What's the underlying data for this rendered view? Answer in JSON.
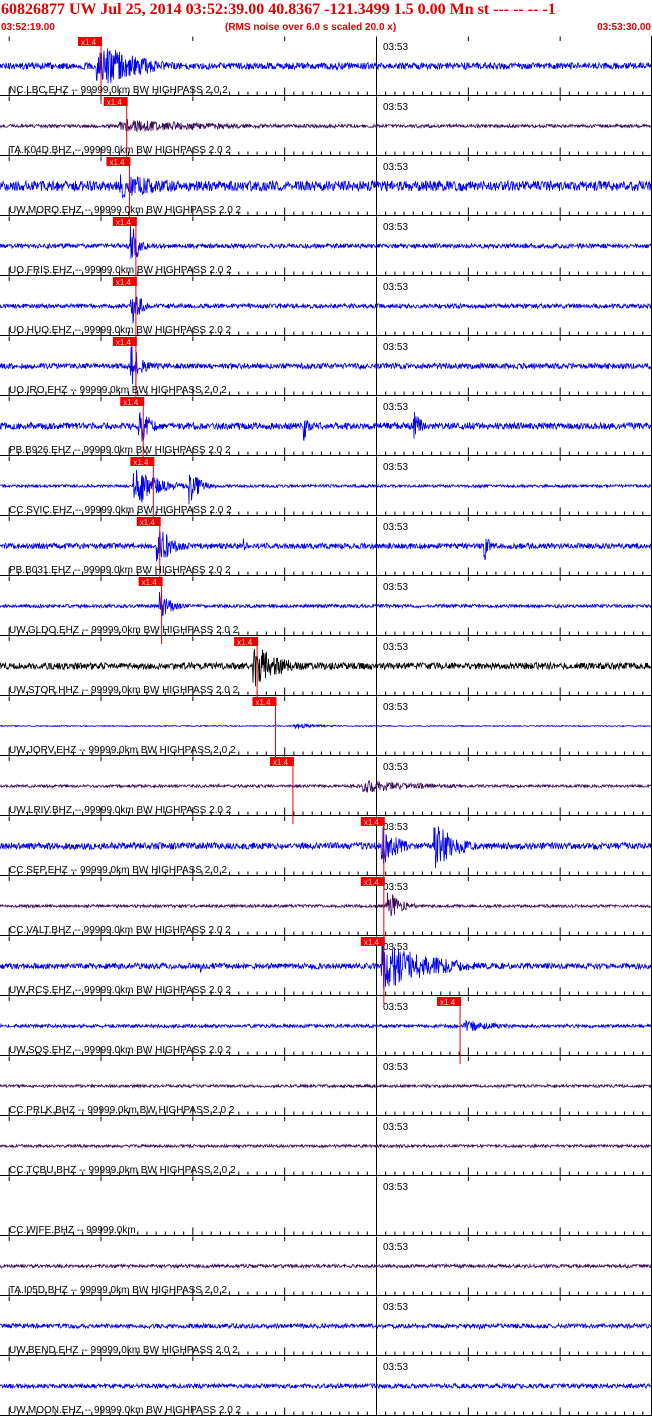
{
  "header": {
    "title": "60826877 UW Jul 25, 2014 03:52:39.00   40.8367 -121.3499  1.5 0.00 Mn st --- -- --  -1",
    "start_time": "03:52:19.00",
    "end_time": "03:53:30.00",
    "note": "(RMS noise over 6.0 s scaled 20.0 x)"
  },
  "colors": {
    "header_text": "#e00000",
    "trace_blue": "#0000ee",
    "trace_purple": "#3a0a5e",
    "trace_black": "#000000",
    "pick_marker": "#ee0000",
    "axis": "#000000"
  },
  "chart_data": {
    "type": "line",
    "x_unit": "time",
    "x_range": [
      "03:52:19.00",
      "03:53:30.00"
    ],
    "minute_mark_label": "03:53",
    "pick_label": "x1.4",
    "traces": [
      {
        "label": "NC.LBC.EHZ -- 99999.0km BW  HIGHPASS  2.0  2",
        "color": "blue",
        "pick_time_s": 9.8,
        "amplitude": 0.12,
        "events": [
          {
            "t": 10.5,
            "dur": 7,
            "amp": 0.95
          }
        ]
      },
      {
        "label": "TA.K04D.BHZ -- 99999.0km BW  HIGHPASS  2.0  2",
        "color": "purple",
        "pick_time_s": 12.6,
        "amplitude": 0.06,
        "events": [
          {
            "t": 13,
            "dur": 20,
            "amp": 0.25
          }
        ]
      },
      {
        "label": "UW.MORO.EHZ -- 99999.0km BW  HIGHPASS  2.0  2",
        "color": "blue",
        "pick_time_s": 12.9,
        "amplitude": 0.18,
        "events": [
          {
            "t": 13,
            "dur": 13,
            "amp": 0.45
          }
        ]
      },
      {
        "label": "UO.FRIS.EHZ -- 99999.0km BW  HIGHPASS  2.0  2",
        "color": "blue",
        "pick_time_s": 13.6,
        "amplitude": 0.08,
        "events": [
          {
            "t": 14.2,
            "dur": 1.5,
            "amp": 1.0
          }
        ]
      },
      {
        "label": "UO.HUO.EHZ -- 99999.0km BW  HIGHPASS  2.0  2",
        "color": "blue",
        "pick_time_s": 13.6,
        "amplitude": 0.08,
        "events": [
          {
            "t": 14.2,
            "dur": 1.5,
            "amp": 1.0
          }
        ]
      },
      {
        "label": "UO.IRO.EHZ -- 99999.0km BW  HIGHPASS  2.0  2",
        "color": "blue",
        "pick_time_s": 13.6,
        "amplitude": 0.1,
        "events": [
          {
            "t": 14.2,
            "dur": 1.8,
            "amp": 0.95
          }
        ]
      },
      {
        "label": "PB.B926.EHZ -- 99999.0km BW  HIGHPASS  2.0  2",
        "color": "blue",
        "pick_time_s": 14.4,
        "amplitude": 0.12,
        "events": [
          {
            "t": 15.0,
            "dur": 2,
            "amp": 0.9
          },
          {
            "t": 33,
            "dur": 0.8,
            "amp": 0.7
          },
          {
            "t": 45,
            "dur": 1.5,
            "amp": 0.6
          }
        ]
      },
      {
        "label": "CC.SVIC.EHZ -- 99999.0km BW  HIGHPASS  2.0  2",
        "color": "blue",
        "pick_time_s": 15.5,
        "amplitude": 0.05,
        "events": [
          {
            "t": 14.5,
            "dur": 4,
            "amp": 0.9
          },
          {
            "t": 20.5,
            "dur": 2,
            "amp": 0.7
          }
        ]
      },
      {
        "label": "PB.B031.EHZ -- 99999.0km BW  HIGHPASS  2.0  2",
        "color": "blue",
        "pick_time_s": 16.2,
        "amplitude": 0.1,
        "events": [
          {
            "t": 17,
            "dur": 3,
            "amp": 0.8
          },
          {
            "t": 26.5,
            "dur": 1,
            "amp": 0.3
          },
          {
            "t": 52.6,
            "dur": 0.8,
            "amp": 0.9
          }
        ]
      },
      {
        "label": "UW.GLDO.EHZ -- 99999.0km BW  HIGHPASS  2.0  2",
        "color": "blue",
        "pick_time_s": 16.4,
        "amplitude": 0.06,
        "events": [
          {
            "t": 17.3,
            "dur": 2,
            "amp": 0.7
          }
        ]
      },
      {
        "label": "UW.STOR.HHZ -- 99999.0km BW  HIGHPASS  2.0  2",
        "color": "black",
        "pick_time_s": 26.8,
        "amplitude": 0.12,
        "events": [
          {
            "t": 27.5,
            "dur": 5,
            "amp": 0.85
          }
        ]
      },
      {
        "label": "UW.JORV.EHZ -- 99999.0km BW  HIGHPASS  2.0  2",
        "color": "blue",
        "pick_time_s": 28.8,
        "amplitude": 0.02,
        "events": [
          {
            "t": 32,
            "dur": 5,
            "amp": 0.12
          }
        ]
      },
      {
        "label": "UW.LRIV.BHZ -- 99999.0km BW  HIGHPASS  2.0  2",
        "color": "purple",
        "pick_time_s": 30.7,
        "amplitude": 0.05,
        "events": [
          {
            "t": 39.5,
            "dur": 12,
            "amp": 0.25
          }
        ]
      },
      {
        "label": "CC.SEP.EHZ -- 99999.0km BW  HIGHPASS  2.0  2",
        "color": "blue",
        "pick_time_s": 40.6,
        "amplitude": 0.12,
        "events": [
          {
            "t": 41.5,
            "dur": 3,
            "amp": 0.8
          },
          {
            "t": 47.2,
            "dur": 4,
            "amp": 0.95
          }
        ]
      },
      {
        "label": "CC.VALT.BHZ -- 99999.0km BW  HIGHPASS  2.0  2",
        "color": "purple",
        "pick_time_s": 40.6,
        "amplitude": 0.05,
        "events": [
          {
            "t": 42,
            "dur": 2.5,
            "amp": 0.7
          }
        ]
      },
      {
        "label": "UW.RCS.EHZ -- 99999.0km BW  HIGHPASS  2.0  2",
        "color": "blue",
        "pick_time_s": 40.6,
        "amplitude": 0.1,
        "events": [
          {
            "t": 41.5,
            "dur": 9,
            "amp": 0.95
          },
          {
            "t": 21.8,
            "dur": 0.6,
            "amp": 0.3
          }
        ]
      },
      {
        "label": "UW.SQS.EHZ -- 99999.0km BW  HIGHPASS  2.0  2",
        "color": "blue",
        "pick_time_s": 48.9,
        "amplitude": 0.06,
        "events": [
          {
            "t": 50.5,
            "dur": 8,
            "amp": 0.22
          }
        ]
      },
      {
        "label": "CC.PRLK.BHZ -- 99999.0km BW  HIGHPASS  2.0  2",
        "color": "purple",
        "pick_time_s": null,
        "amplitude": 0.05,
        "events": []
      },
      {
        "label": "CC.TCBU.BHZ -- 99999.0km BW  HIGHPASS  2.0  2",
        "color": "purple",
        "pick_time_s": null,
        "amplitude": 0.05,
        "events": []
      },
      {
        "label": "CC.WIFE.BHZ -- 99999.0km",
        "color": "none",
        "pick_time_s": null,
        "amplitude": 0,
        "events": []
      },
      {
        "label": "TA.I05D.BHZ -- 99999.0km BW  HIGHPASS  2.0  2",
        "color": "purple",
        "pick_time_s": null,
        "amplitude": 0.06,
        "events": []
      },
      {
        "label": "UW.BEND.EHZ -- 99999.0km BW  HIGHPASS  2.0  2",
        "color": "blue",
        "pick_time_s": null,
        "amplitude": 0.08,
        "events": [
          {
            "t": 52,
            "dur": 1,
            "amp": 0.2
          }
        ]
      },
      {
        "label": "UW.MOON.EHZ -- 99999.0km BW  HIGHPASS  2.0  2",
        "color": "blue",
        "pick_time_s": null,
        "amplitude": 0.08,
        "events": []
      }
    ]
  }
}
